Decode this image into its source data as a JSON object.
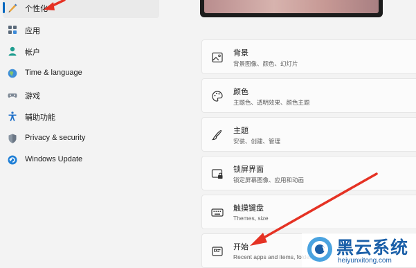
{
  "sidebar": {
    "items": [
      {
        "label": "个性化",
        "icon": "pen-icon",
        "selected": true
      },
      {
        "label": "应用",
        "icon": "apps-icon"
      },
      {
        "label": "帐户",
        "icon": "person-icon"
      },
      {
        "label": "Time & language",
        "icon": "globe-icon"
      },
      {
        "label": "游戏",
        "icon": "gamepad-icon"
      },
      {
        "label": "辅助功能",
        "icon": "accessibility-icon"
      },
      {
        "label": "Privacy & security",
        "icon": "shield-icon"
      },
      {
        "label": "Windows Update",
        "icon": "update-icon"
      }
    ]
  },
  "cards": [
    {
      "title": "背景",
      "subtitle": "背景图像、颜色、幻灯片",
      "icon": "image-icon"
    },
    {
      "title": "颜色",
      "subtitle": "主题色、透明效果、颜色主题",
      "icon": "palette-icon"
    },
    {
      "title": "主题",
      "subtitle": "安装、创建、管理",
      "icon": "brush-icon"
    },
    {
      "title": "锁屏界面",
      "subtitle": "锁定屏幕图像、应用和动画",
      "icon": "lock-screen-icon"
    },
    {
      "title": "触摸键盘",
      "subtitle": "Themes, size",
      "icon": "keyboard-icon"
    },
    {
      "title": "开始",
      "subtitle": "Recent apps and items, folders",
      "icon": "start-icon"
    }
  ],
  "watermark": {
    "name": "黑云系统",
    "url": "heiyunxitong.com"
  },
  "colors": {
    "accent": "#0067c0",
    "arrow": "#e53224",
    "watermark": "#1a5fa8"
  }
}
